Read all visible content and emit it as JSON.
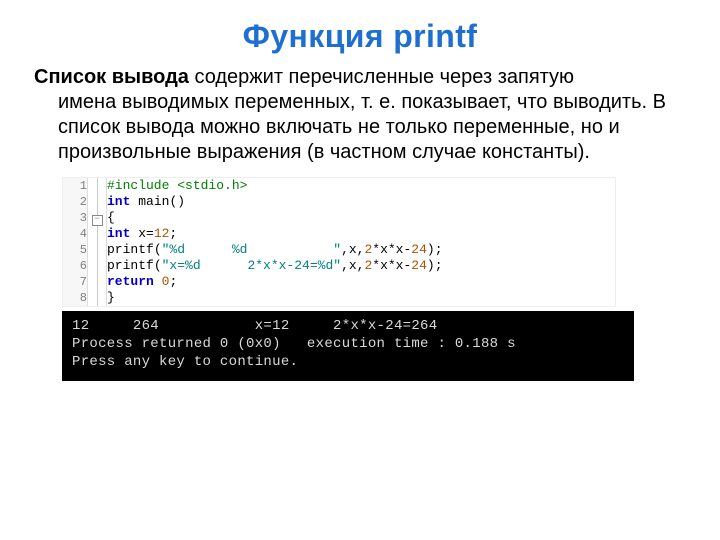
{
  "title": "Функция printf",
  "body": {
    "lead": "Список вывода",
    "text_first": " содержит перечисленные через запятую",
    "text_rest": "имена выводимых переменных, т. е. показывает, что выводить. В список вывода можно включать не только переменные, но и произвольные выражения (в частном случае константы)."
  },
  "code": {
    "lines": [
      {
        "n": 1,
        "segments": [
          {
            "cls": "c-comment",
            "t": "#include "
          },
          {
            "cls": "c-comment",
            "t": "<stdio.h>"
          }
        ]
      },
      {
        "n": 2,
        "segments": [
          {
            "cls": "c-kw",
            "t": "int"
          },
          {
            "cls": "",
            "t": " "
          },
          {
            "cls": "c-fn",
            "t": "main"
          },
          {
            "cls": "",
            "t": "()"
          }
        ]
      },
      {
        "n": 3,
        "fold": true,
        "segments": [
          {
            "cls": "",
            "t": "{"
          }
        ]
      },
      {
        "n": 4,
        "segments": [
          {
            "cls": "c-kw",
            "t": "int"
          },
          {
            "cls": "",
            "t": " x="
          },
          {
            "cls": "c-num",
            "t": "12"
          },
          {
            "cls": "",
            "t": ";"
          }
        ]
      },
      {
        "n": 5,
        "segments": [
          {
            "cls": "c-fn",
            "t": "printf"
          },
          {
            "cls": "",
            "t": "("
          },
          {
            "cls": "c-str",
            "t": "\"%d      %d           \""
          },
          {
            "cls": "",
            "t": ",x,"
          },
          {
            "cls": "c-num",
            "t": "2"
          },
          {
            "cls": "",
            "t": "*x*x-"
          },
          {
            "cls": "c-num",
            "t": "24"
          },
          {
            "cls": "",
            "t": ");"
          }
        ]
      },
      {
        "n": 6,
        "segments": [
          {
            "cls": "c-fn",
            "t": "printf"
          },
          {
            "cls": "",
            "t": "("
          },
          {
            "cls": "c-str",
            "t": "\"x=%d      2*x*x-24=%d\""
          },
          {
            "cls": "",
            "t": ",x,"
          },
          {
            "cls": "c-num",
            "t": "2"
          },
          {
            "cls": "",
            "t": "*x*x-"
          },
          {
            "cls": "c-num",
            "t": "24"
          },
          {
            "cls": "",
            "t": ");"
          }
        ]
      },
      {
        "n": 7,
        "segments": [
          {
            "cls": "c-kw",
            "t": "return"
          },
          {
            "cls": "",
            "t": " "
          },
          {
            "cls": "c-num",
            "t": "0"
          },
          {
            "cls": "",
            "t": ";"
          }
        ]
      },
      {
        "n": 8,
        "segments": [
          {
            "cls": "",
            "t": "}"
          }
        ]
      }
    ]
  },
  "console": {
    "line1": "12     264           x=12     2*x*x-24=264",
    "line2": "Process returned 0 (0x0)   execution time : 0.188 s",
    "line3": "Press any key to continue."
  }
}
